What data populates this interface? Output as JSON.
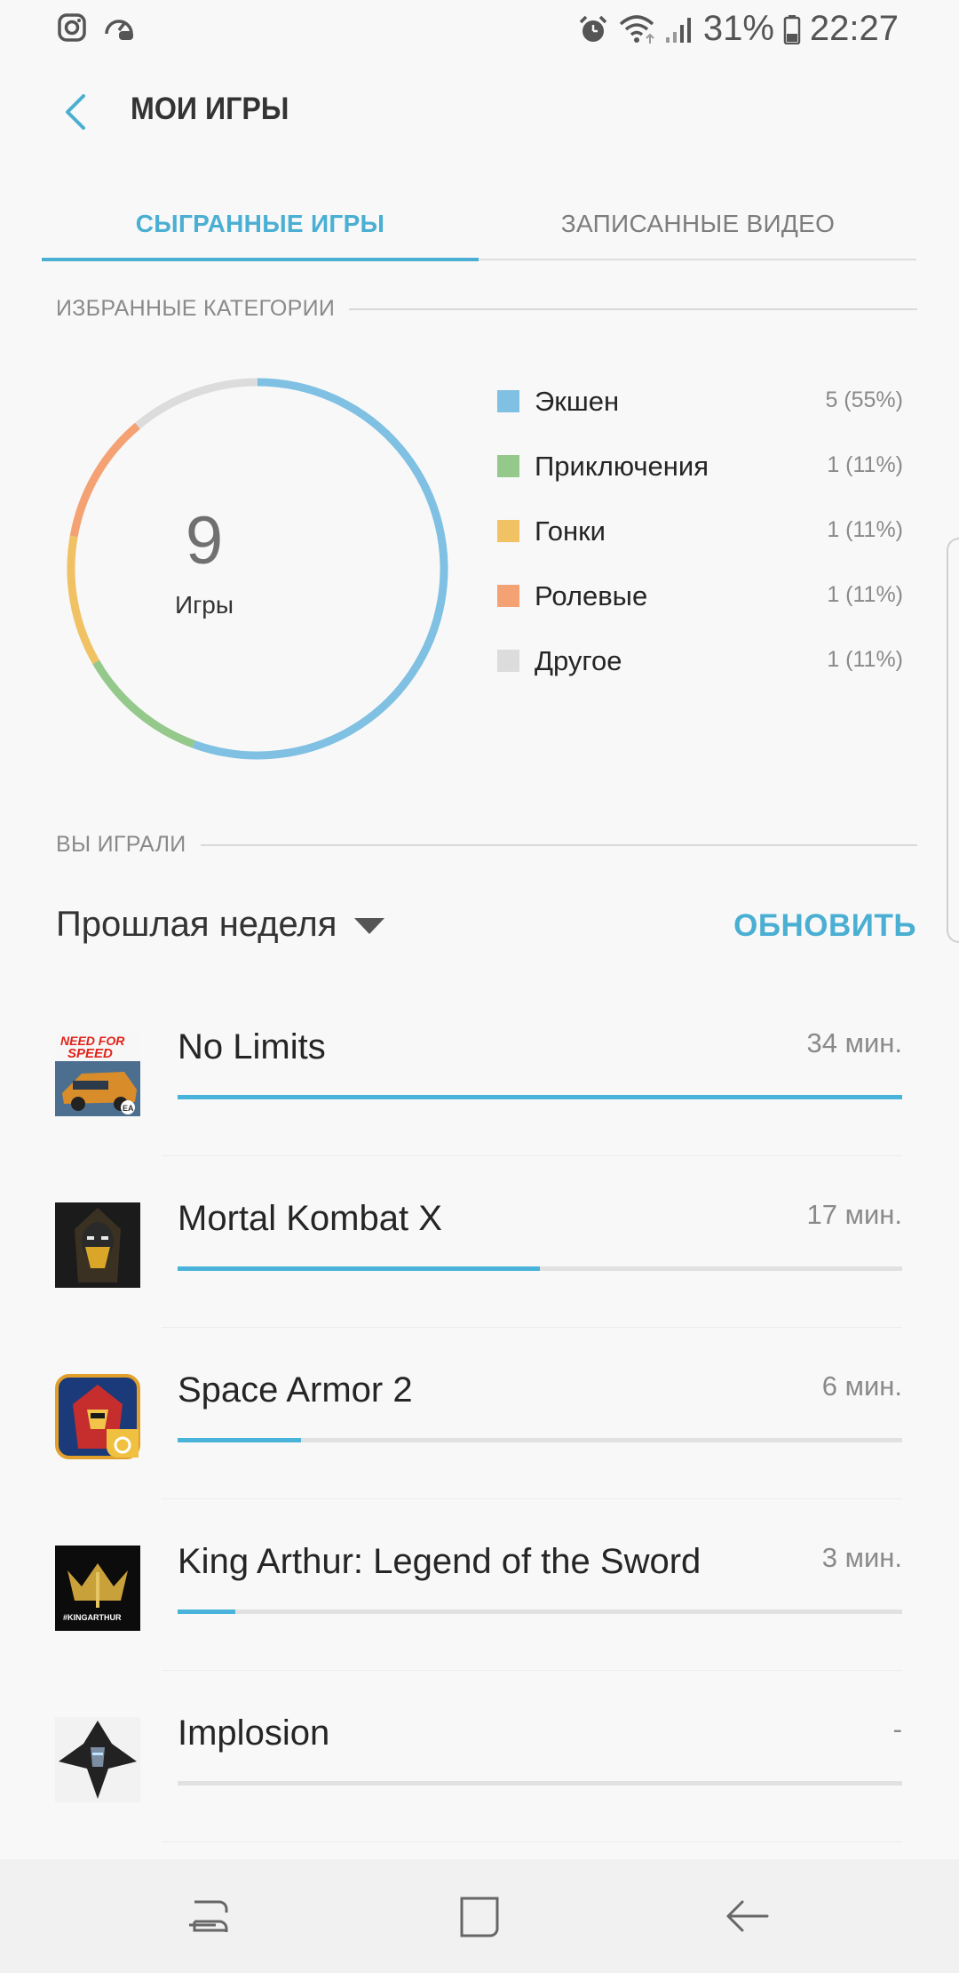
{
  "status_bar": {
    "battery": "31%",
    "time": "22:27"
  },
  "header": {
    "title": "МОИ ИГРЫ"
  },
  "tabs": [
    {
      "label": "СЫГРАННЫЕ ИГРЫ",
      "active": true
    },
    {
      "label": "ЗАПИСАННЫЕ ВИДЕО",
      "active": false
    }
  ],
  "favorites": {
    "section_title": "ИЗБРАННЫЕ КАТЕГОРИИ",
    "total_count": "9",
    "total_label": "Игры",
    "categories": [
      {
        "name": "Экшен",
        "value": "5 (55%)",
        "count": 5,
        "color": "#7fc0e3"
      },
      {
        "name": "Приключения",
        "value": "1 (11%)",
        "count": 1,
        "color": "#94c98b"
      },
      {
        "name": "Гонки",
        "value": "1 (11%)",
        "count": 1,
        "color": "#f0c264"
      },
      {
        "name": "Ролевые",
        "value": "1 (11%)",
        "count": 1,
        "color": "#f4a274"
      },
      {
        "name": "Другое",
        "value": "1 (11%)",
        "count": 1,
        "color": "#dcdcdc"
      }
    ]
  },
  "played": {
    "section_title": "ВЫ ИГРАЛИ",
    "period": "Прошлая неделя",
    "refresh_label": "ОБНОВИТЬ",
    "games": [
      {
        "name": "No Limits",
        "time": "34 мин.",
        "progress": 1.0,
        "icon": "need-for-speed-icon"
      },
      {
        "name": "Mortal Kombat X",
        "time": "17 мин.",
        "progress": 0.5,
        "icon": "mortal-kombat-icon"
      },
      {
        "name": "Space Armor 2",
        "time": "6 мин.",
        "progress": 0.17,
        "icon": "space-armor-icon"
      },
      {
        "name": "King Arthur: Legend of the Sword",
        "time": "3 мин.",
        "progress": 0.08,
        "icon": "king-arthur-icon"
      },
      {
        "name": "Implosion",
        "time": "-",
        "progress": 0.0,
        "icon": "implosion-icon"
      }
    ]
  },
  "colors": {
    "accent": "#4aafd2"
  }
}
